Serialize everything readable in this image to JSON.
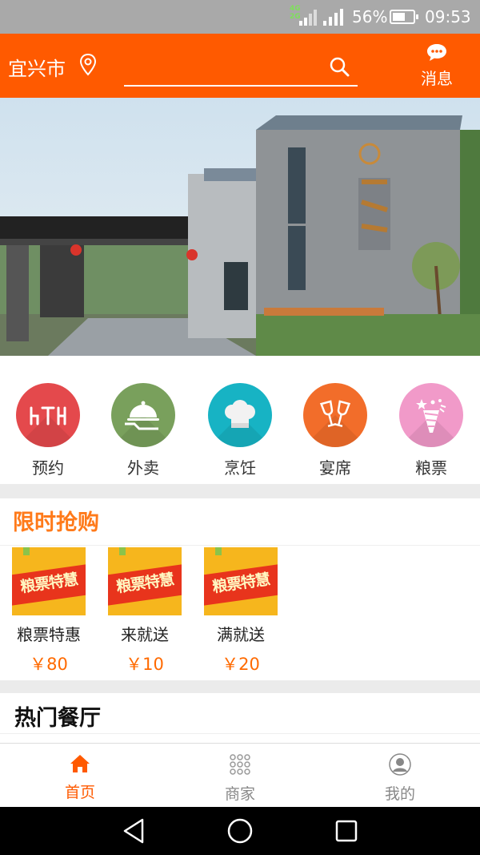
{
  "status_bar": {
    "network_top": "4G",
    "network_bottom": "2G",
    "battery_percent": "56%",
    "time": "09:53"
  },
  "header": {
    "city": "宜兴市",
    "search_placeholder": "",
    "messages_label": "消息",
    "background_color": "#ff5a00"
  },
  "banner": {
    "slide_count": 2,
    "active_slide": 2
  },
  "categories": [
    {
      "label": "预约",
      "icon": "dining-table-icon",
      "color": "#e4494c"
    },
    {
      "label": "外卖",
      "icon": "food-cloche-icon",
      "color": "#79a05c"
    },
    {
      "label": "烹饪",
      "icon": "chef-hat-icon",
      "color": "#17b3c4"
    },
    {
      "label": "宴席",
      "icon": "wine-glasses-icon",
      "color": "#f26d2a"
    },
    {
      "label": "粮票",
      "icon": "coupon-bouquet-icon",
      "color": "#f19ac9"
    }
  ],
  "flash_sale": {
    "title": "限时抢购",
    "items": [
      {
        "image_text": "粮票特慧",
        "name": "粮票特惠",
        "price": "￥80"
      },
      {
        "image_text": "粮票特慧",
        "name": "来就送",
        "price": "￥10"
      },
      {
        "image_text": "粮票特慧",
        "name": "满就送",
        "price": "￥20"
      }
    ]
  },
  "hot_restaurants": {
    "title": "热门餐厅"
  },
  "bottom_nav": [
    {
      "label": "首页",
      "icon": "home-icon",
      "active": true
    },
    {
      "label": "商家",
      "icon": "grid-dots-icon",
      "active": false
    },
    {
      "label": "我的",
      "icon": "user-icon",
      "active": false
    }
  ],
  "colors": {
    "accent": "#ff5a00",
    "flash_title": "#ff7a1a",
    "price": "#ff6a00"
  }
}
